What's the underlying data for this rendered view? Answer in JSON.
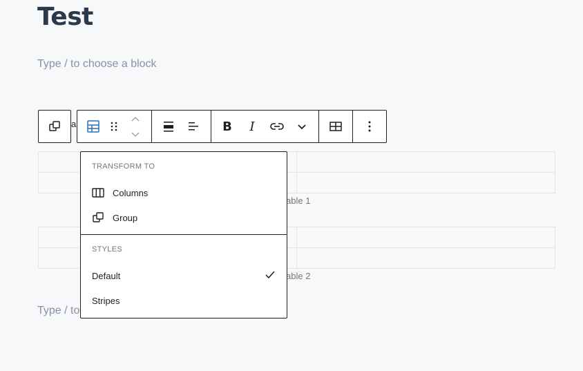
{
  "editor": {
    "title": "Test",
    "placeholder_top": "Type / to choose a block",
    "placeholder_bottom": "Type / to",
    "peek_text": "a"
  },
  "tables": [
    {
      "caption": "able 1"
    },
    {
      "caption": "able 2"
    }
  ],
  "toolbar": {
    "icons": [
      "group-icon",
      "table-icon",
      "drag-handle-icon",
      "move-up-icon",
      "move-down-icon",
      "align-wide-icon",
      "align-left-icon",
      "bold-icon",
      "italic-icon",
      "link-icon",
      "more-rich-text-icon",
      "table-edit-icon",
      "options-icon"
    ],
    "bold_glyph": "B",
    "italic_glyph": "I",
    "accent_color": "#2271b1"
  },
  "menu": {
    "transform_heading": "TRANSFORM TO",
    "transform_items": [
      "Columns",
      "Group"
    ],
    "styles_heading": "STYLES",
    "style_items": [
      "Default",
      "Stripes"
    ],
    "selected_style": "Default"
  }
}
